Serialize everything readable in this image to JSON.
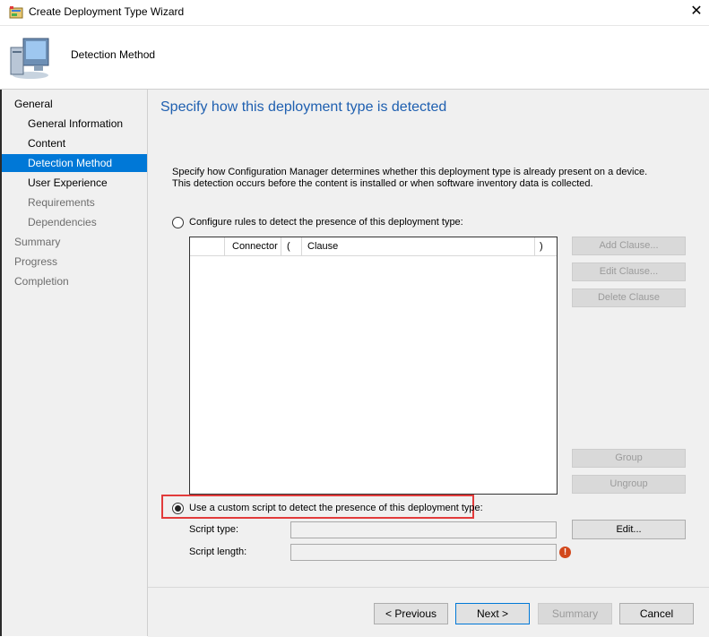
{
  "window": {
    "title": "Create Deployment Type Wizard",
    "close_glyph": "✕"
  },
  "header": {
    "title": "Detection Method",
    "icon": "computer-icon"
  },
  "nav": {
    "items": [
      {
        "label": "General",
        "level": 1,
        "state": "normal"
      },
      {
        "label": "General Information",
        "level": 2,
        "state": "normal"
      },
      {
        "label": "Content",
        "level": 2,
        "state": "normal"
      },
      {
        "label": "Detection Method",
        "level": 2,
        "state": "selected"
      },
      {
        "label": "User Experience",
        "level": 2,
        "state": "normal"
      },
      {
        "label": "Requirements",
        "level": 2,
        "state": "dim"
      },
      {
        "label": "Dependencies",
        "level": 2,
        "state": "dim"
      },
      {
        "label": "Summary",
        "level": 1,
        "state": "dim"
      },
      {
        "label": "Progress",
        "level": 1,
        "state": "dim"
      },
      {
        "label": "Completion",
        "level": 1,
        "state": "dim"
      }
    ]
  },
  "main": {
    "heading": "Specify how this deployment type is detected",
    "description": "Specify how Configuration Manager determines whether this deployment type is already present on a device. This detection occurs before the content is installed or when software inventory data is collected.",
    "option_rules": {
      "label": "Configure rules to detect the presence of this deployment type:",
      "selected": false
    },
    "rules_table": {
      "columns": [
        "Connector",
        "(",
        "Clause",
        ")"
      ]
    },
    "clause_buttons": {
      "add": "Add Clause...",
      "edit": "Edit Clause...",
      "delete": "Delete Clause",
      "group": "Group",
      "ungroup": "Ungroup"
    },
    "option_script": {
      "label": "Use a custom script to detect the presence of this deployment type:",
      "selected": true
    },
    "script_type_label": "Script type:",
    "script_type_value": "",
    "script_length_label": "Script length:",
    "script_length_value": "",
    "edit_button": "Edit...",
    "error_glyph": "!"
  },
  "footer": {
    "previous": "< Previous",
    "next": "Next >",
    "summary": "Summary",
    "cancel": "Cancel"
  },
  "colors": {
    "accent": "#0078d7",
    "heading": "#1e5fb0",
    "highlight_border": "#e23b3b",
    "error": "#d2481c"
  }
}
